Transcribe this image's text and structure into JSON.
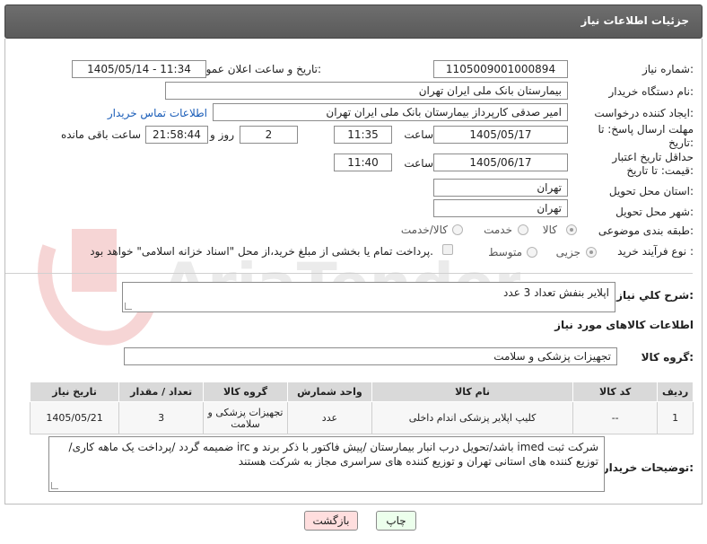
{
  "header": {
    "title": "جزئیات اطلاعات نیاز"
  },
  "labels": {
    "need_number": "شماره نیاز:",
    "announce_datetime": "تاریخ و ساعت اعلان عمومی:",
    "buyer_org": "نام دستگاه خریدار:",
    "requester": "ایجاد کننده درخواست:",
    "reply_deadline": "مهلت ارسال پاسخ: تا تاریخ:",
    "price_validity": "حداقل تاریخ اعتبار قیمت: تا تاریخ:",
    "time": "ساعت",
    "day_and": "روز و",
    "remaining": "ساعت باقی مانده",
    "delivery_province": "استان محل تحویل:",
    "delivery_city": "شهر محل تحویل:",
    "subject_category": "طبقه بندی موضوعی:",
    "purchase_process": "نوع فرآیند خرید :",
    "general_desc": "شرح کلي نياز:",
    "goods_info": "اطلاعات کالاهای مورد نیاز",
    "goods_group": "گروه کالا:",
    "buyer_notes": "توضیحات خریدار:"
  },
  "fields": {
    "need_number": "1105009001000894",
    "announce_datetime": "1405/05/14 - 11:34",
    "buyer_org": "بیمارستان بانک ملی ایران تهران",
    "requester": "امیر صدقی کارپرداز بیمارستان بانک ملی ایران تهران",
    "buyer_contact_link": "اطلاعات تماس خریدار",
    "reply_date": "1405/05/17",
    "reply_time": "11:35",
    "reply_days": "2",
    "reply_remaining": "21:58:44",
    "price_date": "1405/06/17",
    "price_time": "11:40",
    "delivery_province": "تهران",
    "delivery_city": "تهران",
    "general_desc": "اپلایر بنفش تعداد 3 عدد",
    "goods_group": "تجهیزات پزشکی و سلامت",
    "buyer_notes": "شرکت ثبت imed باشد/تحویل درب انبار بیمارستان /پیش فاکتور با ذکر برند و irc ضمیمه گردد /پرداخت یک ماهه کاری/ توزیع کننده های استانی تهران و توزیع کننده های سراسری مجاز به شرکت هستند"
  },
  "subject_options": [
    {
      "label": "کالا",
      "selected": true
    },
    {
      "label": "خدمت",
      "selected": false
    },
    {
      "label": "کالا/خدمت",
      "selected": false
    }
  ],
  "process_options": [
    {
      "label": "جزیی",
      "selected": true
    },
    {
      "label": "متوسط",
      "selected": false
    }
  ],
  "payment_note": "پرداخت تمام یا بخشی از مبلغ خرید،از محل \"اسناد خزانه اسلامی\" خواهد بود.",
  "table": {
    "headers": [
      "ردیف",
      "کد کالا",
      "نام کالا",
      "واحد شمارش",
      "گروه کالا",
      "تعداد / مقدار",
      "تاریخ نیاز"
    ],
    "rows": [
      [
        "1",
        "--",
        "کلیپ اپلایر پزشکی اندام داخلی",
        "عدد",
        "تجهیزات پزشکی و سلامت",
        "3",
        "1405/05/21"
      ]
    ]
  },
  "buttons": {
    "print": "چاپ",
    "back": "بازگشت"
  },
  "watermark": "AriaTender.net",
  "colors": {
    "header_bg": "#5f5f5f",
    "link": "#1a5db8",
    "table_header": "#d9d9d9",
    "print_btn": "#ecffec",
    "back_btn": "#ffdede"
  }
}
